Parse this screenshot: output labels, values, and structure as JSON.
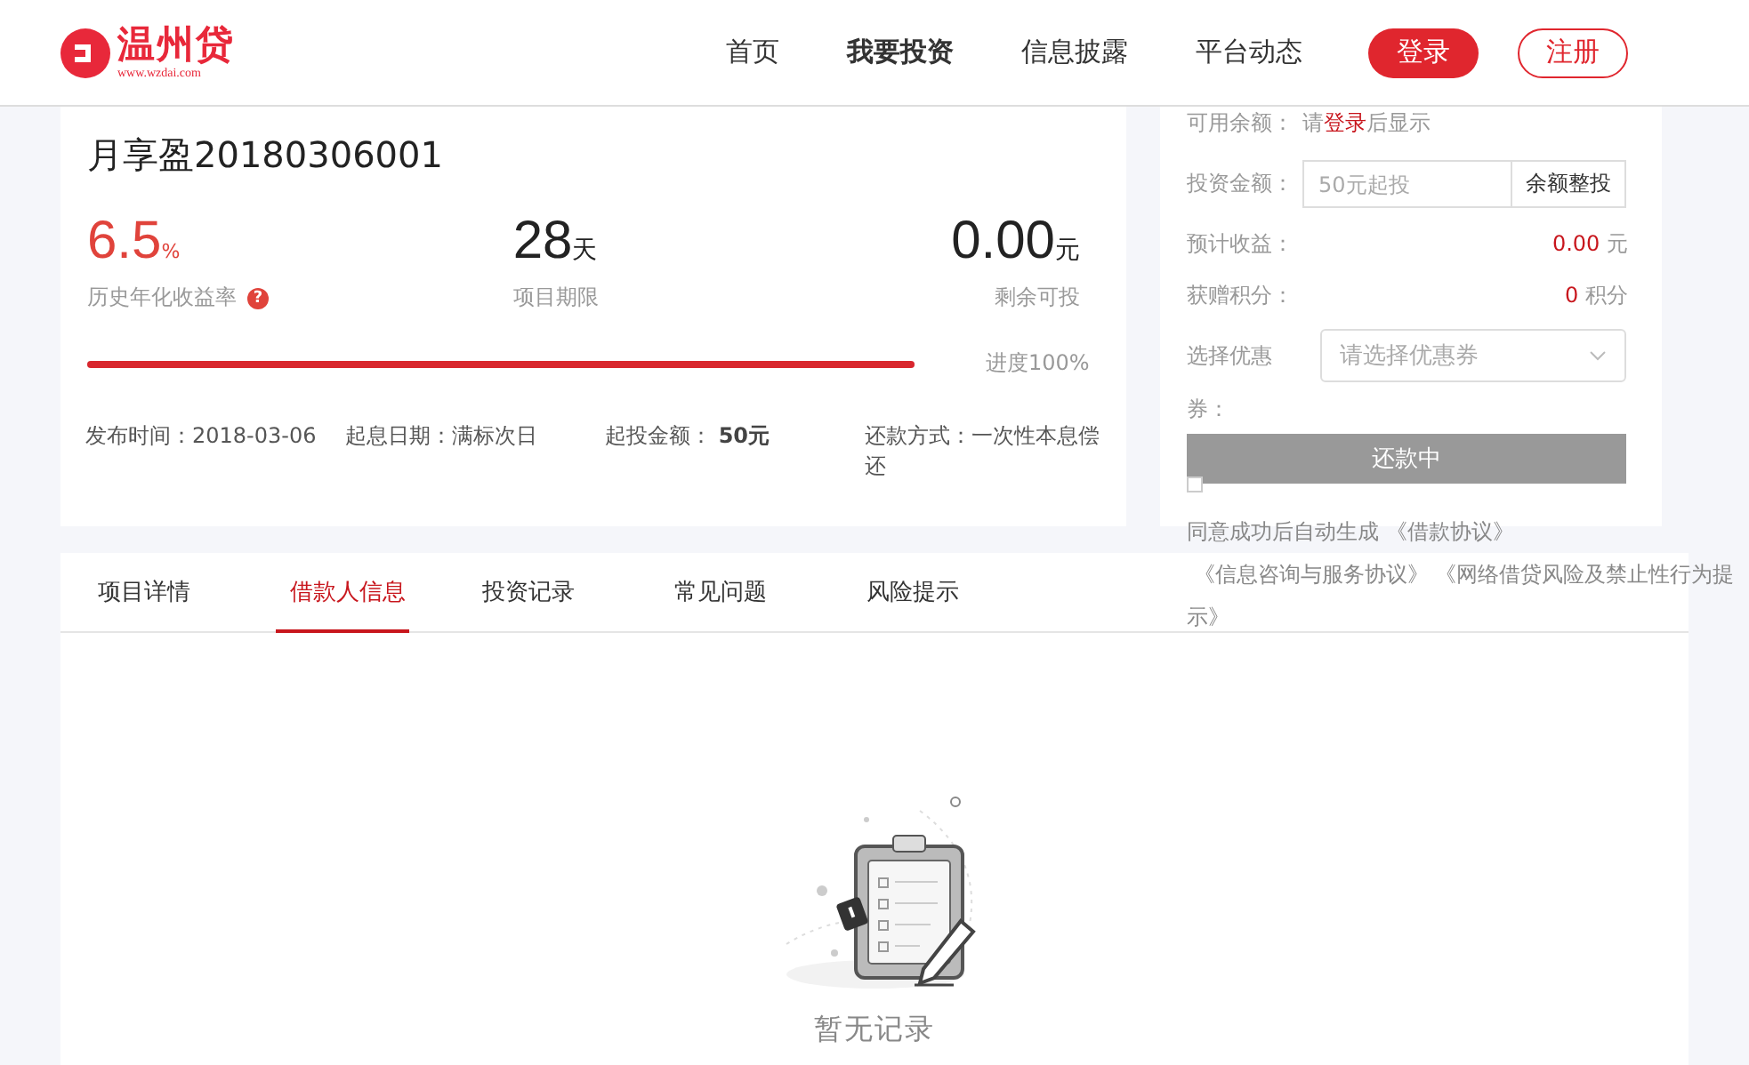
{
  "header": {
    "logo_text": "温州贷",
    "logo_url": "www.wzdai.com",
    "nav": [
      {
        "label": "首页",
        "selected": false
      },
      {
        "label": "我要投资",
        "selected": true
      },
      {
        "label": "信息披露",
        "selected": false
      },
      {
        "label": "平台动态",
        "selected": false
      }
    ],
    "login": "登录",
    "register": "注册"
  },
  "product": {
    "title": "月享盈20180306001",
    "stats": [
      {
        "value": "6.5",
        "unit": "%",
        "label": "历史年化收益率",
        "help": "?",
        "kind": "rate"
      },
      {
        "value": "28",
        "unit": "天",
        "label": "项目期限",
        "kind": "term"
      },
      {
        "value": "0.00",
        "unit": "元",
        "label": "剩余可投",
        "kind": "remain"
      }
    ],
    "progress": {
      "level": 1.0,
      "reading": "进度100%"
    },
    "info": [
      {
        "label": "发布时间：",
        "value": "2018-03-06"
      },
      {
        "label": "起息日期：",
        "value": "满标次日"
      },
      {
        "label": "起投金额：",
        "value": "50元"
      },
      {
        "label": "还款方式：",
        "value": "一次性本息偿还"
      }
    ]
  },
  "invest": {
    "balance_label": "可用余额：",
    "balance_pre": "请",
    "balance_link": "登录",
    "balance_post": "后显示",
    "amount_label": "投资金额：",
    "amount_placeholder": "50元起投",
    "all_in_button": "余额整投",
    "income_label": "预计收益：",
    "income_value": "0.00",
    "income_unit": "元",
    "points_label": "获赠积分：",
    "points_value": "0",
    "points_unit": "积分",
    "coupon_label": "选择优惠券：",
    "coupon_placeholder": "请选择优惠券",
    "submit": "还款中",
    "agree_checked": false,
    "agree_text": "同意成功后自动生成 《借款协议》",
    "agree_more": " 《信息咨询与服务协议》 《网络借贷风险及禁止性行为提示》"
  },
  "tabs": [
    {
      "label": "项目详情",
      "selected": false
    },
    {
      "label": "借款人信息",
      "selected": true
    },
    {
      "label": "投资记录",
      "selected": false
    },
    {
      "label": "常见问题",
      "selected": false
    },
    {
      "label": "风险提示",
      "selected": false
    }
  ],
  "empty": {
    "text": "暂无记录"
  }
}
